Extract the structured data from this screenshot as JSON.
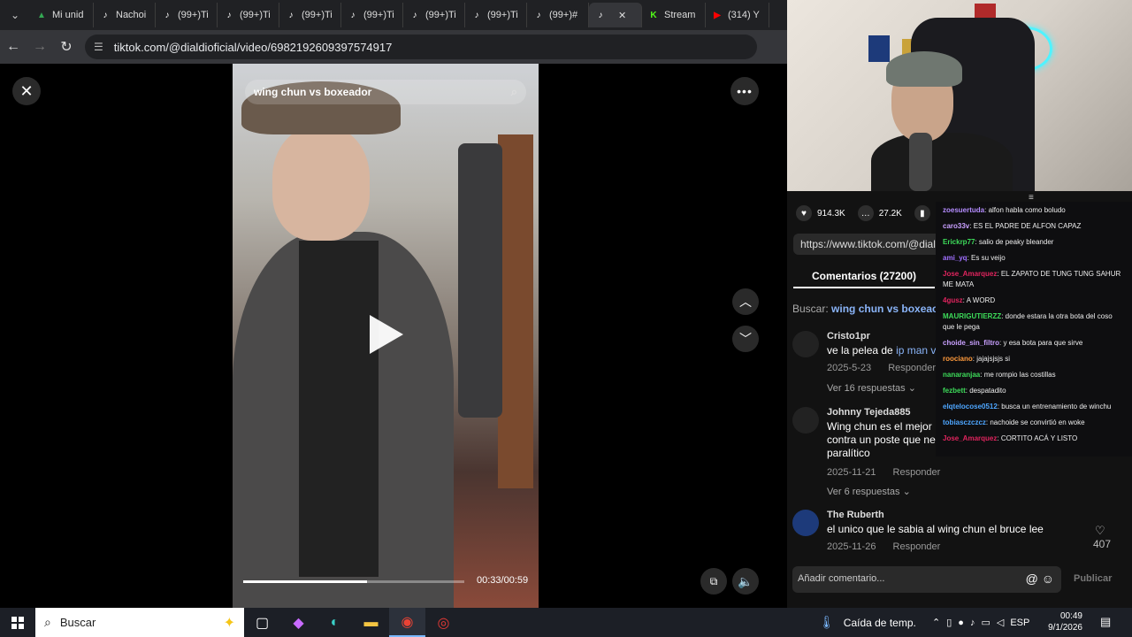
{
  "browser": {
    "tabs": [
      {
        "label": "Mi unid",
        "icon": "drive-icon",
        "color": "#34a853"
      },
      {
        "label": "Nachoi",
        "icon": "tiktok-icon",
        "color": "#ffffff"
      },
      {
        "label": "(99+)Ti",
        "icon": "tiktok-icon",
        "color": "#ffffff"
      },
      {
        "label": "(99+)Ti",
        "icon": "tiktok-icon",
        "color": "#ffffff"
      },
      {
        "label": "(99+)Ti",
        "icon": "tiktok-icon",
        "color": "#ffffff"
      },
      {
        "label": "(99+)Ti",
        "icon": "tiktok-icon",
        "color": "#ffffff"
      },
      {
        "label": "(99+)Ti",
        "icon": "tiktok-icon",
        "color": "#ffffff"
      },
      {
        "label": "(99+)Ti",
        "icon": "tiktok-icon",
        "color": "#ffffff"
      },
      {
        "label": "(99+)#",
        "icon": "tiktok-icon",
        "color": "#ffffff"
      },
      {
        "label": "",
        "icon": "tiktok-icon",
        "color": "#ffffff"
      },
      {
        "label": "Stream",
        "icon": "kick-icon",
        "color": "#53fc18"
      },
      {
        "label": "(314) Y",
        "icon": "youtube-icon",
        "color": "#ff0000"
      }
    ],
    "url": "tiktok.com/@dialdioficial/video/6982192609397574917"
  },
  "video": {
    "search_text": "wing chun vs boxeador",
    "time": "00:33/00:59",
    "progress": 0.56
  },
  "panel": {
    "likes": "914.3K",
    "comments_count": "27.2K",
    "share_url": "https://www.tiktok.com/@dialdi",
    "comments_tab": "Comentarios (27200)",
    "search_prefix": "Buscar:",
    "search_query": "wing chun vs boxeac",
    "comments": [
      {
        "user": "Cristo1pr",
        "text": "ve la pelea de",
        "link": "ip man v",
        "date": "2025-5-23",
        "reply": "Responder",
        "replies": "Ver 16 respuestas"
      },
      {
        "user": "Johnny Tejeda885",
        "text": "Wing chun es el mejor contra un poste que ne paralítico",
        "date": "2025-11-21",
        "reply": "Responder",
        "replies": "Ver 6 respuestas"
      },
      {
        "user": "The Ruberth",
        "text": "el unico que le sabia al wing chun el bruce lee",
        "date": "2025-11-26",
        "reply": "Responder",
        "likes": "407"
      }
    ],
    "input_placeholder": "Añadir comentario...",
    "publish": "Publicar"
  },
  "chat": [
    {
      "user": "zoesuertuda",
      "color": "#b48cff",
      "msg": "alfon habla como boludo"
    },
    {
      "user": "caro33v",
      "color": "#c9a0ff",
      "msg": "ES EL PADRE DE ALFON CAPAZ"
    },
    {
      "user": "Erickrp77",
      "color": "#3ddc5a",
      "msg": "salio de peaky bleander"
    },
    {
      "user": "ami_yq",
      "color": "#a070ff",
      "msg": "Es su veijo"
    },
    {
      "user": "Jose_Amarquez",
      "color": "#e0245e",
      "msg": "EL ZAPATO DE TUNG TUNG SAHUR ME MATA"
    },
    {
      "user": "4gusz",
      "color": "#e0245e",
      "msg": "A WORD"
    },
    {
      "user": "MAURIGUTIERZZ",
      "color": "#3ddc5a",
      "msg": "donde estara la otra bota del coso que le pega"
    },
    {
      "user": "choide_sin_filtro",
      "color": "#c9a0ff",
      "msg": "y esa bota para que sirve"
    },
    {
      "user": "roociano",
      "color": "#ff9a3c",
      "msg": "jajajsjsjs si"
    },
    {
      "user": "nanaranjaa",
      "color": "#3ddc5a",
      "msg": "me rompio las costillas"
    },
    {
      "user": "fezbett",
      "color": "#3ddc5a",
      "msg": "despatadito"
    },
    {
      "user": "elqtelocose0512",
      "color": "#4ea6ff",
      "msg": "busca un entrenamiento de winchu"
    },
    {
      "user": "tobiasczczcz",
      "color": "#4ea6ff",
      "msg": "nachoide se convirtió en woke"
    },
    {
      "user": "Jose_Amarquez",
      "color": "#e0245e",
      "msg": "CORTITO ACÁ Y LISTO"
    }
  ],
  "taskbar": {
    "search": "Buscar",
    "weather": "Caída de temp.",
    "lang": "ESP",
    "time": "00:49",
    "date": "9/1/2026"
  }
}
